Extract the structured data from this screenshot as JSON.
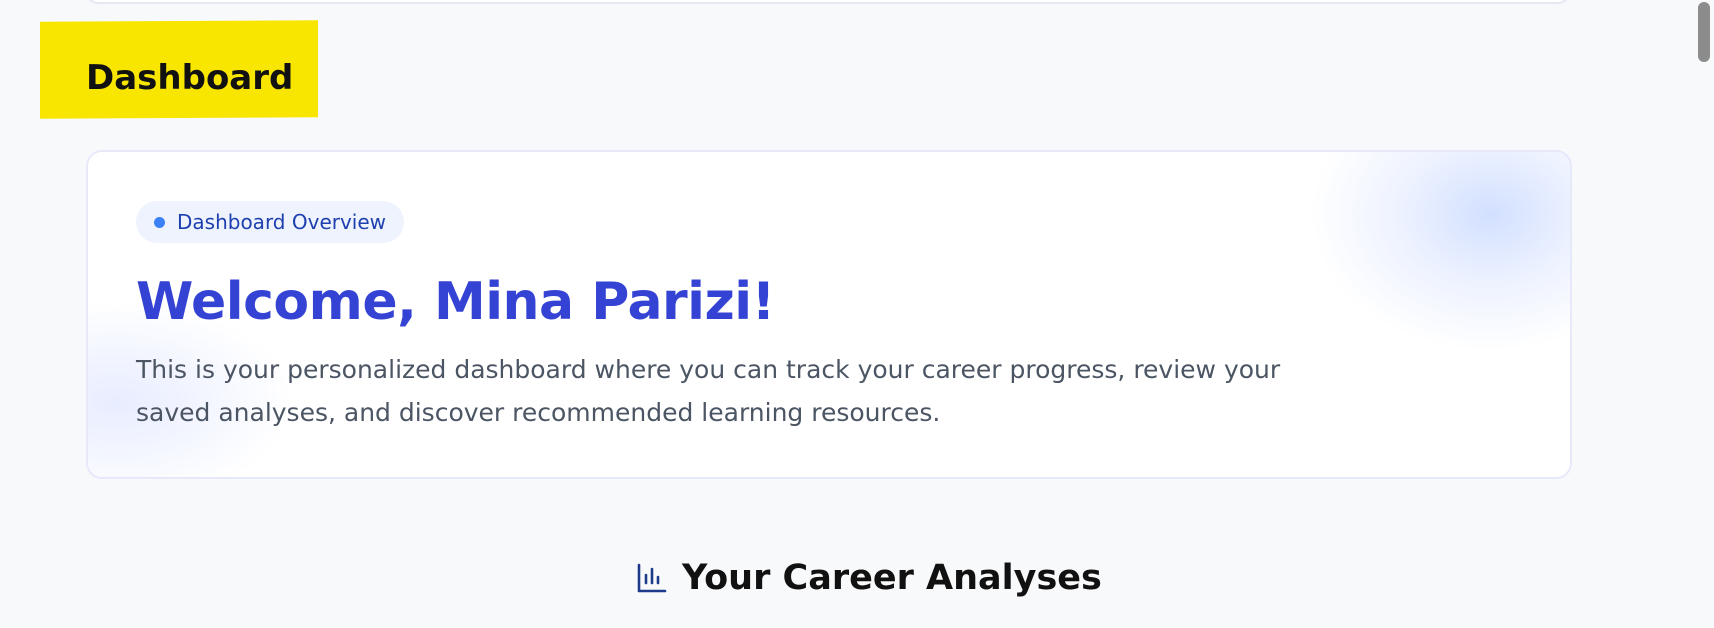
{
  "page": {
    "title": "Dashboard"
  },
  "welcome_card": {
    "badge_label": "Dashboard Overview",
    "heading": "Welcome, Mina Parizi!",
    "description": "This is your personalized dashboard where you can track your career progress, review your saved analyses, and discover recommended learning resources."
  },
  "analyses_section": {
    "icon": "bar-chart-icon",
    "title": "Your Career Analyses"
  },
  "colors": {
    "highlight": "#f8e600",
    "heading_accent": "#3543d4",
    "badge_dot": "#3b82f6",
    "badge_text": "#1e40af",
    "badge_bg": "#eef3fd"
  }
}
